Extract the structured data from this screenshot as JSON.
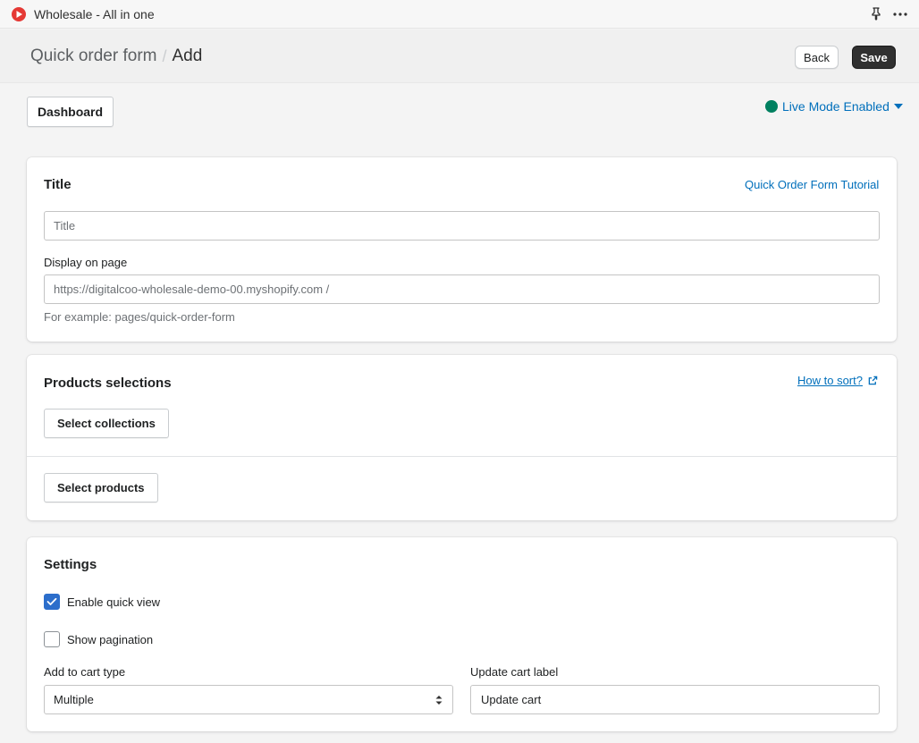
{
  "app": {
    "name": "Wholesale - All in one"
  },
  "header": {
    "breadcrumb_parent": "Quick order form",
    "breadcrumb_current": "Add",
    "back_label": "Back",
    "save_label": "Save"
  },
  "toolbar": {
    "dashboard_label": "Dashboard",
    "live_mode_label": "Live Mode Enabled",
    "live_mode_color": "#008060"
  },
  "title_card": {
    "heading": "Title",
    "tutorial_link": "Quick Order Form Tutorial",
    "title_placeholder": "Title",
    "title_value": "",
    "display_label": "Display on page",
    "display_placeholder": "https://digitalcoo-wholesale-demo-00.myshopify.com /",
    "display_value": "",
    "display_help": "For example: pages/quick-order-form"
  },
  "products_card": {
    "heading": "Products selections",
    "sort_link": "How to sort?",
    "select_collections_label": "Select collections",
    "select_products_label": "Select products"
  },
  "settings_card": {
    "heading": "Settings",
    "enable_quick_view_label": "Enable quick view",
    "enable_quick_view_checked": true,
    "show_pagination_label": "Show pagination",
    "show_pagination_checked": false,
    "add_to_cart_type_label": "Add to cart type",
    "add_to_cart_type_value": "Multiple",
    "update_cart_label_label": "Update cart label",
    "update_cart_label_value": "Update cart"
  },
  "colors": {
    "accent_link": "#006fbb",
    "checkbox_checked": "#2c6ecb",
    "save_button": "#303030"
  }
}
